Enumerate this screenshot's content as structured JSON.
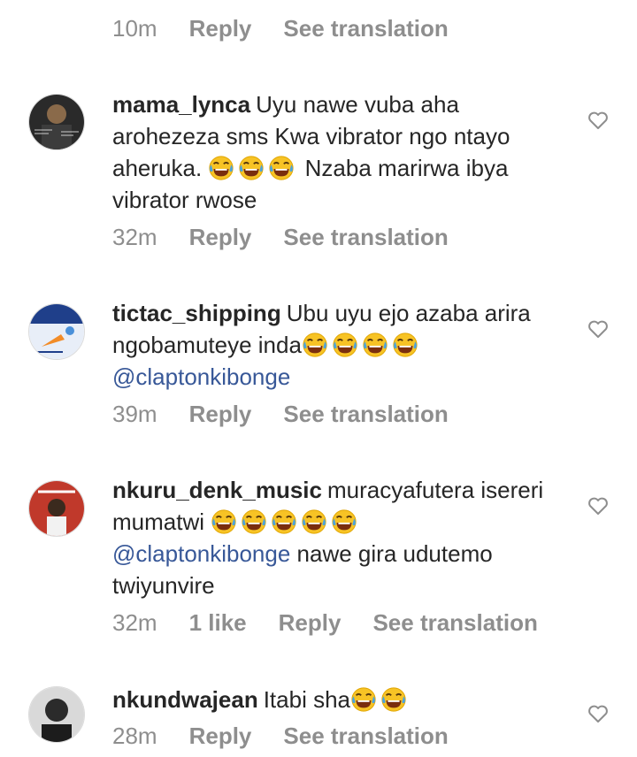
{
  "top_meta": {
    "time": "10m",
    "reply": "Reply",
    "translate": "See translation"
  },
  "comments": [
    {
      "username": "mama_lynca",
      "text_1": "Uyu nawe vuba aha arohezeza sms Kwa vibrator ngo ntayo aheruka.",
      "text_2": "Nzaba marirwa ibya vibrator rwose",
      "time": "32m",
      "reply": "Reply",
      "translate": "See translation"
    },
    {
      "username": "tictac_shipping",
      "text_1": "Ubu uyu ejo azaba arira ngobamuteye inda",
      "mention": "@claptonkibonge",
      "time": "39m",
      "reply": "Reply",
      "translate": "See translation"
    },
    {
      "username": "nkuru_denk_music",
      "text_1": "muracyafutera isereri mumatwi",
      "mention": "@claptonkibonge",
      "text_2": "nawe gira udutemo twiyunvire",
      "time": "32m",
      "likes": "1 like",
      "reply": "Reply",
      "translate": "See translation"
    },
    {
      "username": "nkundwajean",
      "text_1": "Itabi sha",
      "time": "28m",
      "reply": "Reply",
      "translate": "See translation"
    }
  ],
  "icons": {
    "heart": "heart-outline-icon",
    "emoji": "face-with-tears-of-joy-icon"
  },
  "colors": {
    "meta": "#8e8e8e",
    "text": "#262626",
    "mention": "#385898"
  }
}
